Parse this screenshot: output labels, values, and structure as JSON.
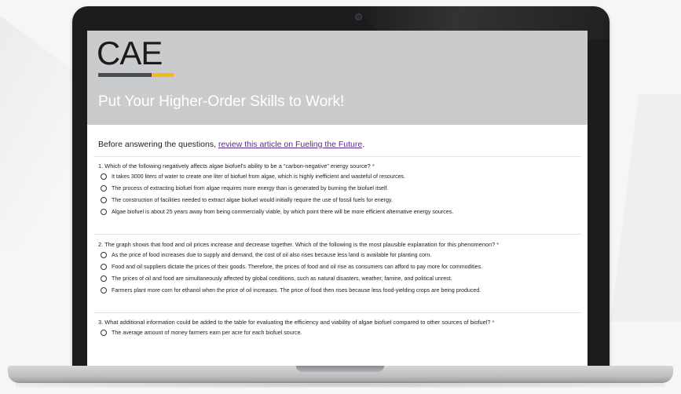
{
  "page": {
    "logo_text": "CAE",
    "banner_title": "Put Your Higher-Order Skills to Work!",
    "intro_prefix": "Before answering the questions, ",
    "intro_link": "review this article on Fueling the Future",
    "intro_suffix": ".",
    "required_marker": "*",
    "colors": {
      "banner": "#c9cbcd",
      "logo_bar_dark": "#4a4d52",
      "logo_bar_gold": "#f3b81e",
      "link": "#5a2a8a",
      "required": "#d0021b"
    }
  },
  "questions": [
    {
      "text": "1. Which of the following negatively affects algae biofuel's ability to be a “carbon-negative” energy source?",
      "options": [
        "It takes 3000 liters of water to create one liter of biofuel from algae, which is highly inefficient and wasteful of resources.",
        "The process of extracting biofuel from algae requires more energy than is generated by burning the biofuel itself.",
        "The construction of facilities needed to extract algae biofuel would initially require the use of fossil fuels for energy.",
        "Algae biofuel is about 25 years away from being commercially viable, by which point there will be more efficient alternative energy sources."
      ]
    },
    {
      "text": "2. The graph shows that food and oil prices increase and decrease together. Which of the following is the most plausible explanation for this phenomenon?",
      "options": [
        "As the price of food increases due to supply and demand, the cost of oil also rises because less land is available for planting corn.",
        "Food and oil suppliers dictate the prices of their goods. Therefore, the prices of food and oil rise as consumers can afford to pay more for commodities.",
        "The prices of oil and food are simultaneously affected by global conditions, such as natural disasters, weather, famine, and political unrest.",
        "Farmers plant more corn for ethanol when the price of oil increases. The price of food then rises because less food-yielding crops are being produced."
      ]
    },
    {
      "text": "3. What additional information could be added to the table for evaluating the efficiency and viability of algae biofuel compared to other sources of biofuel?",
      "options": [
        "The average amount of money farmers earn per acre for each biofuel source."
      ]
    }
  ]
}
